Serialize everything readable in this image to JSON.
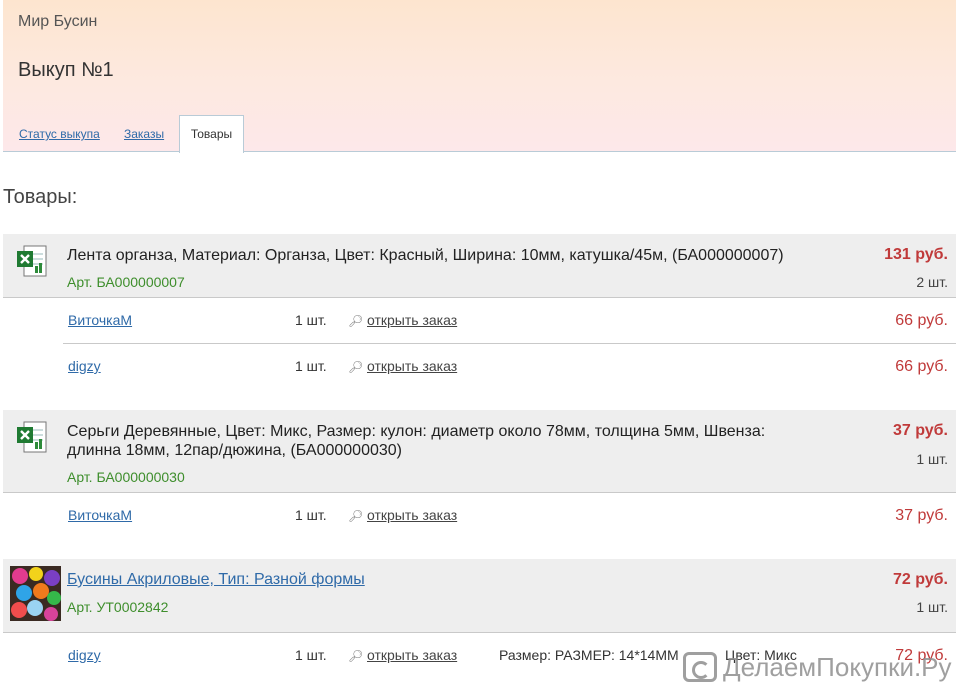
{
  "header": {
    "site_name": "Мир Бусин",
    "title": "Выкуп №1",
    "tabs": [
      "Статус выкупа",
      "Заказы",
      "Товары"
    ]
  },
  "section_title": "Товары:",
  "products": [
    {
      "name": "Лента органза, Материал: Органза, Цвет: Красный, Ширина: 10мм, катушка/45м, (БА000000007)",
      "art": "Арт. БА000000007",
      "price": "131 руб.",
      "qty": "2 шт.",
      "orders": [
        {
          "buyer": "ВиточкаМ",
          "qty": "1 шт.",
          "open": "открыть заказ",
          "price": "66 руб."
        },
        {
          "buyer": "digzy",
          "qty": "1 шт.",
          "open": "открыть заказ",
          "price": "66 руб."
        }
      ]
    },
    {
      "name": "Серьги Деревянные, Цвет: Микс, Размер: кулон: диаметр около 78мм, толщина 5мм, Швенза: длинна 18мм, 12пар/дюжина, (БА000000030)",
      "art": "Арт. БА000000030",
      "price": "37 руб.",
      "qty": "1 шт.",
      "orders": [
        {
          "buyer": "ВиточкаМ",
          "qty": "1 шт.",
          "open": "открыть заказ",
          "price": "37 руб."
        }
      ]
    },
    {
      "name": "Бусины Акриловые, Тип: Разной формы",
      "art": "Арт. УТ0002842",
      "price": "72 руб.",
      "qty": "1 шт.",
      "orders": [
        {
          "buyer": "digzy",
          "qty": "1 шт.",
          "open": "открыть заказ",
          "size": "Размер: РАЗМЕР: 14*14ММ",
          "color": "Цвет: Микс",
          "price": "72 руб."
        }
      ]
    }
  ],
  "watermark": "ДелаемПокупки.Ру",
  "colors": {
    "link": "#2f6aa8",
    "price": "#c03a3a",
    "article": "#3e8e2c"
  }
}
